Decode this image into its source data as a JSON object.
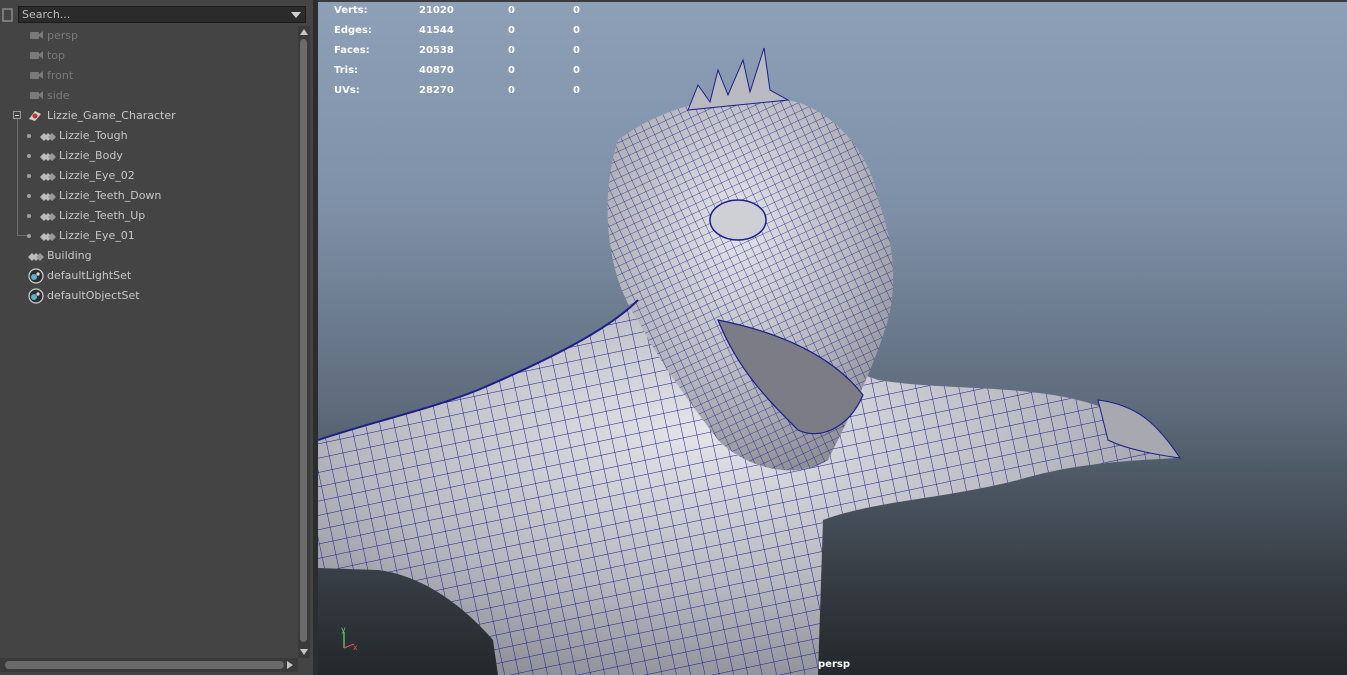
{
  "outliner": {
    "search": {
      "placeholder": "Search..."
    },
    "items": [
      {
        "label": "persp",
        "type": "camera",
        "dim": true
      },
      {
        "label": "top",
        "type": "camera",
        "dim": true
      },
      {
        "label": "front",
        "type": "camera",
        "dim": true
      },
      {
        "label": "side",
        "type": "camera",
        "dim": true
      },
      {
        "label": "Lizzie_Game_Character",
        "type": "group"
      },
      {
        "label": "Lizzie_Tough",
        "type": "mesh"
      },
      {
        "label": "Lizzie_Body",
        "type": "mesh"
      },
      {
        "label": "Lizzie_Eye_02",
        "type": "mesh"
      },
      {
        "label": "Lizzie_Teeth_Down",
        "type": "mesh"
      },
      {
        "label": "Lizzie_Teeth_Up",
        "type": "mesh"
      },
      {
        "label": "Lizzie_Eye_01",
        "type": "mesh"
      },
      {
        "label": "Building",
        "type": "mesh"
      },
      {
        "label": "defaultLightSet",
        "type": "set"
      },
      {
        "label": "defaultObjectSet",
        "type": "set"
      }
    ]
  },
  "viewport": {
    "camera": "persp",
    "axis": {
      "y": "y",
      "x": "x"
    },
    "stats": [
      {
        "label": "Verts:",
        "v1": "21020",
        "v2": "0",
        "v3": "0"
      },
      {
        "label": "Edges:",
        "v1": "41544",
        "v2": "0",
        "v3": "0"
      },
      {
        "label": "Faces:",
        "v1": "20538",
        "v2": "0",
        "v3": "0"
      },
      {
        "label": "Tris:",
        "v1": "40870",
        "v2": "0",
        "v3": "0"
      },
      {
        "label": "UVs:",
        "v1": "28270",
        "v2": "0",
        "v3": "0"
      }
    ]
  },
  "colors": {
    "panel_bg": "#444444",
    "wireframe": "#1a1f8a",
    "mesh_fill": "#c4c4ca",
    "icon_red": "#c9302c"
  }
}
